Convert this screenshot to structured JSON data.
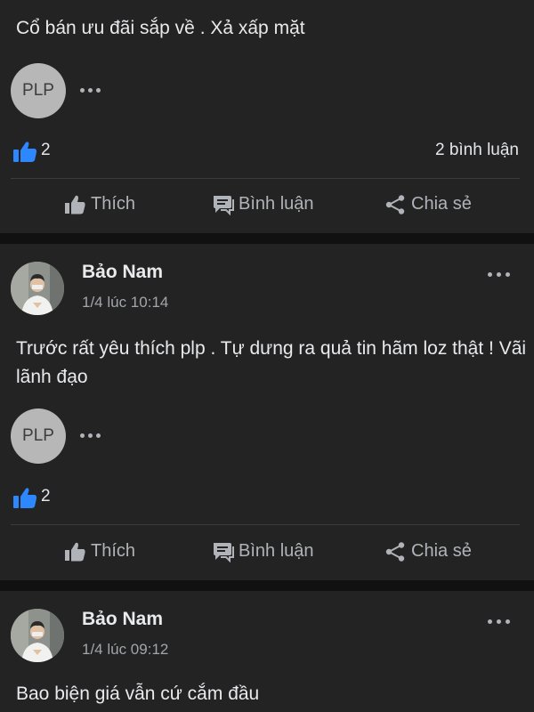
{
  "post1": {
    "text": "Cổ bán ưu đãi sắp về . Xả xấp mặt",
    "page_avatar": "PLP",
    "like_count": "2",
    "comment_count": "2 bình luận"
  },
  "post2": {
    "author": "Bảo Nam",
    "timestamp": "1/4 lúc 10:14",
    "text": "Trước rất yêu thích plp . Tự dưng ra quả tin hãm loz thật ! Vãi lãnh đạo",
    "page_avatar": "PLP",
    "like_count": "2"
  },
  "post3": {
    "author": "Bảo Nam",
    "timestamp": "1/4 lúc 09:12",
    "text": "Bao biện giá vẫn cứ cắm đầu"
  },
  "actions": {
    "like": "Thích",
    "comment": "Bình luận",
    "share": "Chia sẻ"
  },
  "colors": {
    "background": "#111112",
    "card": "#232324",
    "like_blue": "#2d88ff",
    "muted_text": "#b0b3b8"
  },
  "icons": [
    "more-dots-icon",
    "like-thumb-icon",
    "comment-icon",
    "share-icon"
  ]
}
